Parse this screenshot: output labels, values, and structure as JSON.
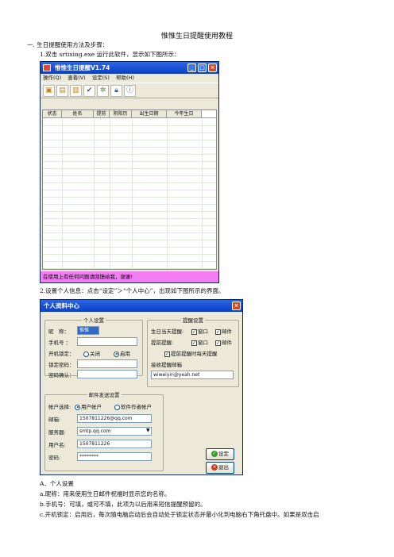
{
  "doc": {
    "title": "惟惟生日提醒使用教程",
    "h1": "一. 生日提醒使用方法及步骤：",
    "p1": "1.双击 srtixing.exe 运行此软件，显示如下图所示：",
    "p2": "2.设置个人信息：点击“设定”＞“个人中心”，出现如下图所示的界面。",
    "secA": "A．个人设置",
    "la": "a.昵称：用来使用生日邮件祝福时显示您的名称。",
    "lb": "b.手机号：可填，或可不填，此项为以后用来短信提醒预留的。",
    "lc": "c.开机锁定：启用后，每次随电脑启动后会自动处于锁定状态并最小化到电脑右下角托盘中。如果是双击启"
  },
  "main": {
    "title": "惟惟生日提醒V1.74",
    "menu": [
      "操作(Q)",
      "查看(V)",
      "设定(S)",
      "帮助(H)"
    ],
    "columns": [
      "状态",
      "姓名",
      "提前",
      "阴阳历",
      "出生日期",
      "今年生日"
    ],
    "status": "在使用上有任何问题请回馈给我，谢谢!",
    "controls": [
      "_",
      "□",
      "×"
    ]
  },
  "dialog": {
    "title": "个人资料中心",
    "close": "×",
    "personal": {
      "legend": "个人设置",
      "nick_label": "昵　称：",
      "nick": "惟惟",
      "phone_label": "手机号 ：",
      "lock_label": "开机锁定：",
      "off": "关闭",
      "on": "启用",
      "pwd_label": "锁定密码：",
      "confirm_label": "密码确认："
    },
    "remind": {
      "legend": "提醒设置",
      "today_label": "生日当天提醒:",
      "early_label": "提前提醒:",
      "window": "窗口",
      "mail": "邮件",
      "daily": "提前提醒时每天提醒",
      "recv_label": "接收提醒邮箱",
      "recv": "wiweiyin@yeah.net"
    },
    "mail": {
      "legend": "邮件发送设置",
      "acct_label": "帐户选择:",
      "user_acct": "用户帐户",
      "soft_acct": "软件作者帐户",
      "mail_label": "邮箱:",
      "mail": "1507811226@qq.com",
      "server_label": "服务器:",
      "server": "smtp.qq.com",
      "user_label": "用户名:",
      "user": "1507811226",
      "pass_label": "密码:",
      "pass": "********"
    },
    "ok": "设定",
    "exit": "退出"
  }
}
